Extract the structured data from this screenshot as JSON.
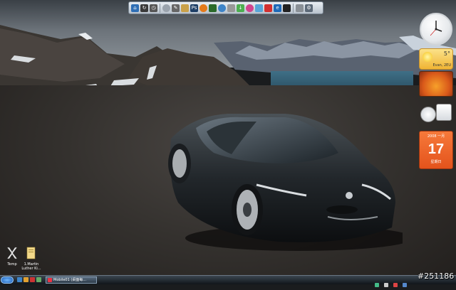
{
  "desktop": {
    "icons": [
      {
        "label": "Temp",
        "icon": "x-app-icon"
      },
      {
        "label": "1.Martin Luther Ki...",
        "icon": "folder-icon"
      }
    ]
  },
  "dock": {
    "icons": [
      "home-icon",
      "refresh-icon",
      "clock-icon",
      "disc-icon",
      "wrench-icon",
      "book-icon",
      "photoshop-icon",
      "browser-icon",
      "ball-icon",
      "globe-icon",
      "dots-icon",
      "download-icon",
      "flower-icon",
      "magnifier-icon",
      "flag-icon",
      "ie-icon",
      "speaker-icon",
      "dark-icon",
      "trash-icon",
      "settings-icon"
    ],
    "ps_label": "Ps"
  },
  "gadgets": {
    "weather": {
      "temp": "5°",
      "city": "Evan, 2EU"
    },
    "calendar": {
      "header": "2008 一月",
      "day": "17",
      "weekday": "星期日"
    }
  },
  "taskbar": {
    "task_label": "Mobile01 (桌面每...",
    "watermark": "#251186"
  },
  "colors": {
    "accent": "#e4531c",
    "taskbar": "#1e262e",
    "sky": "#6c737a"
  }
}
